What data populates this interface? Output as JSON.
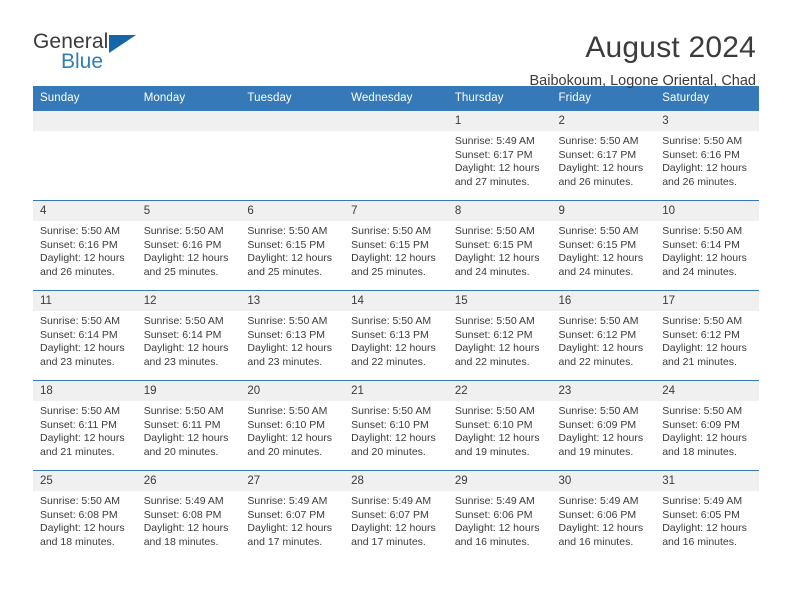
{
  "logo": {
    "text_top": "General",
    "text_bottom": "Blue",
    "triangle": "triangle-icon",
    "color_top": "#3b3b3b",
    "color_bottom": "#2e7ebb",
    "color_triangle": "#1565a8"
  },
  "header": {
    "title": "August 2024",
    "subtitle": "Baibokoum, Logone Oriental, Chad"
  },
  "theme": {
    "header_bg": "#3579b8",
    "daynum_bg": "#f0f0f0",
    "text": "#3b3b3b"
  },
  "weekdays": [
    "Sunday",
    "Monday",
    "Tuesday",
    "Wednesday",
    "Thursday",
    "Friday",
    "Saturday"
  ],
  "weeks": [
    [
      {
        "day": "",
        "lines": []
      },
      {
        "day": "",
        "lines": []
      },
      {
        "day": "",
        "lines": []
      },
      {
        "day": "",
        "lines": []
      },
      {
        "day": "1",
        "lines": [
          "Sunrise: 5:49 AM",
          "Sunset: 6:17 PM",
          "Daylight: 12 hours",
          "and 27 minutes."
        ]
      },
      {
        "day": "2",
        "lines": [
          "Sunrise: 5:50 AM",
          "Sunset: 6:17 PM",
          "Daylight: 12 hours",
          "and 26 minutes."
        ]
      },
      {
        "day": "3",
        "lines": [
          "Sunrise: 5:50 AM",
          "Sunset: 6:16 PM",
          "Daylight: 12 hours",
          "and 26 minutes."
        ]
      }
    ],
    [
      {
        "day": "4",
        "lines": [
          "Sunrise: 5:50 AM",
          "Sunset: 6:16 PM",
          "Daylight: 12 hours",
          "and 26 minutes."
        ]
      },
      {
        "day": "5",
        "lines": [
          "Sunrise: 5:50 AM",
          "Sunset: 6:16 PM",
          "Daylight: 12 hours",
          "and 25 minutes."
        ]
      },
      {
        "day": "6",
        "lines": [
          "Sunrise: 5:50 AM",
          "Sunset: 6:15 PM",
          "Daylight: 12 hours",
          "and 25 minutes."
        ]
      },
      {
        "day": "7",
        "lines": [
          "Sunrise: 5:50 AM",
          "Sunset: 6:15 PM",
          "Daylight: 12 hours",
          "and 25 minutes."
        ]
      },
      {
        "day": "8",
        "lines": [
          "Sunrise: 5:50 AM",
          "Sunset: 6:15 PM",
          "Daylight: 12 hours",
          "and 24 minutes."
        ]
      },
      {
        "day": "9",
        "lines": [
          "Sunrise: 5:50 AM",
          "Sunset: 6:15 PM",
          "Daylight: 12 hours",
          "and 24 minutes."
        ]
      },
      {
        "day": "10",
        "lines": [
          "Sunrise: 5:50 AM",
          "Sunset: 6:14 PM",
          "Daylight: 12 hours",
          "and 24 minutes."
        ]
      }
    ],
    [
      {
        "day": "11",
        "lines": [
          "Sunrise: 5:50 AM",
          "Sunset: 6:14 PM",
          "Daylight: 12 hours",
          "and 23 minutes."
        ]
      },
      {
        "day": "12",
        "lines": [
          "Sunrise: 5:50 AM",
          "Sunset: 6:14 PM",
          "Daylight: 12 hours",
          "and 23 minutes."
        ]
      },
      {
        "day": "13",
        "lines": [
          "Sunrise: 5:50 AM",
          "Sunset: 6:13 PM",
          "Daylight: 12 hours",
          "and 23 minutes."
        ]
      },
      {
        "day": "14",
        "lines": [
          "Sunrise: 5:50 AM",
          "Sunset: 6:13 PM",
          "Daylight: 12 hours",
          "and 22 minutes."
        ]
      },
      {
        "day": "15",
        "lines": [
          "Sunrise: 5:50 AM",
          "Sunset: 6:12 PM",
          "Daylight: 12 hours",
          "and 22 minutes."
        ]
      },
      {
        "day": "16",
        "lines": [
          "Sunrise: 5:50 AM",
          "Sunset: 6:12 PM",
          "Daylight: 12 hours",
          "and 22 minutes."
        ]
      },
      {
        "day": "17",
        "lines": [
          "Sunrise: 5:50 AM",
          "Sunset: 6:12 PM",
          "Daylight: 12 hours",
          "and 21 minutes."
        ]
      }
    ],
    [
      {
        "day": "18",
        "lines": [
          "Sunrise: 5:50 AM",
          "Sunset: 6:11 PM",
          "Daylight: 12 hours",
          "and 21 minutes."
        ]
      },
      {
        "day": "19",
        "lines": [
          "Sunrise: 5:50 AM",
          "Sunset: 6:11 PM",
          "Daylight: 12 hours",
          "and 20 minutes."
        ]
      },
      {
        "day": "20",
        "lines": [
          "Sunrise: 5:50 AM",
          "Sunset: 6:10 PM",
          "Daylight: 12 hours",
          "and 20 minutes."
        ]
      },
      {
        "day": "21",
        "lines": [
          "Sunrise: 5:50 AM",
          "Sunset: 6:10 PM",
          "Daylight: 12 hours",
          "and 20 minutes."
        ]
      },
      {
        "day": "22",
        "lines": [
          "Sunrise: 5:50 AM",
          "Sunset: 6:10 PM",
          "Daylight: 12 hours",
          "and 19 minutes."
        ]
      },
      {
        "day": "23",
        "lines": [
          "Sunrise: 5:50 AM",
          "Sunset: 6:09 PM",
          "Daylight: 12 hours",
          "and 19 minutes."
        ]
      },
      {
        "day": "24",
        "lines": [
          "Sunrise: 5:50 AM",
          "Sunset: 6:09 PM",
          "Daylight: 12 hours",
          "and 18 minutes."
        ]
      }
    ],
    [
      {
        "day": "25",
        "lines": [
          "Sunrise: 5:50 AM",
          "Sunset: 6:08 PM",
          "Daylight: 12 hours",
          "and 18 minutes."
        ]
      },
      {
        "day": "26",
        "lines": [
          "Sunrise: 5:49 AM",
          "Sunset: 6:08 PM",
          "Daylight: 12 hours",
          "and 18 minutes."
        ]
      },
      {
        "day": "27",
        "lines": [
          "Sunrise: 5:49 AM",
          "Sunset: 6:07 PM",
          "Daylight: 12 hours",
          "and 17 minutes."
        ]
      },
      {
        "day": "28",
        "lines": [
          "Sunrise: 5:49 AM",
          "Sunset: 6:07 PM",
          "Daylight: 12 hours",
          "and 17 minutes."
        ]
      },
      {
        "day": "29",
        "lines": [
          "Sunrise: 5:49 AM",
          "Sunset: 6:06 PM",
          "Daylight: 12 hours",
          "and 16 minutes."
        ]
      },
      {
        "day": "30",
        "lines": [
          "Sunrise: 5:49 AM",
          "Sunset: 6:06 PM",
          "Daylight: 12 hours",
          "and 16 minutes."
        ]
      },
      {
        "day": "31",
        "lines": [
          "Sunrise: 5:49 AM",
          "Sunset: 6:05 PM",
          "Daylight: 12 hours",
          "and 16 minutes."
        ]
      }
    ]
  ]
}
